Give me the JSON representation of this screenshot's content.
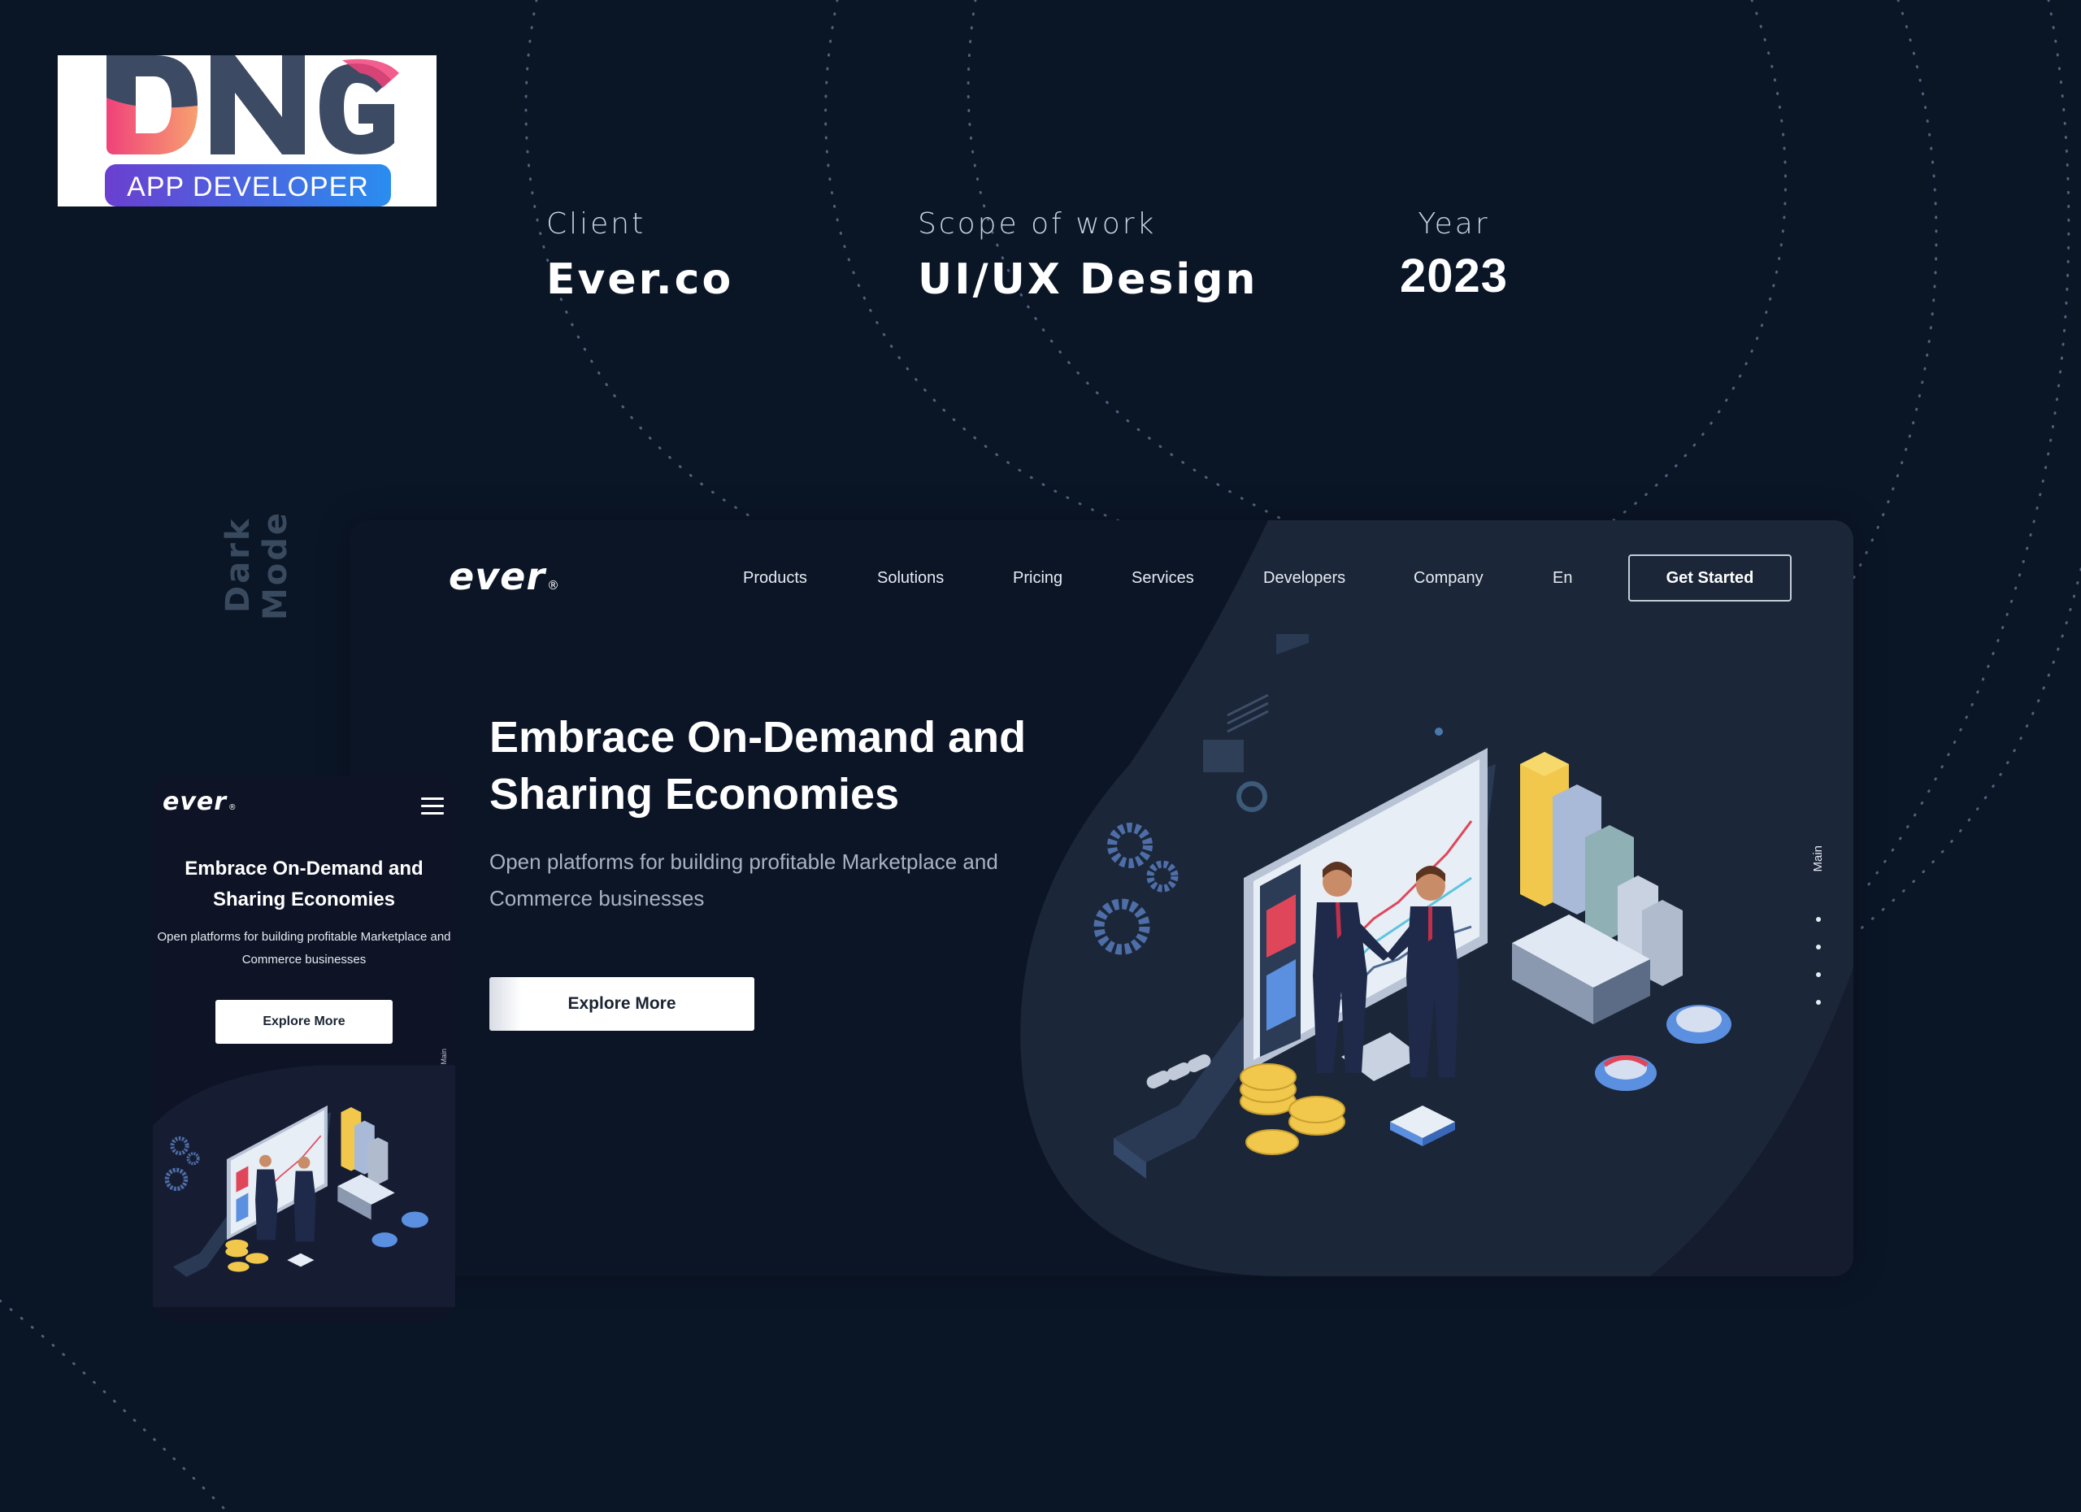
{
  "brand": {
    "name": "DNG",
    "tagline": "APP DEVELOPER",
    "colors": {
      "dark": "#3d4a63",
      "pink": "#f0427a",
      "orange": "#f7a070",
      "purple": "#6a3fd0",
      "blue": "#2a8df0"
    }
  },
  "meta": {
    "client_label": "Client",
    "client_value": "Ever.co",
    "scope_label": "Scope of work",
    "scope_value": "UI/UX Design",
    "year_label": "Year",
    "year_value": "2023"
  },
  "mode_label": "Dark Mode",
  "desktop": {
    "logo": "ever",
    "logo_mark": "®",
    "nav": [
      "Products",
      "Solutions",
      "Pricing",
      "Services",
      "Developers",
      "Company",
      "En"
    ],
    "cta": "Get Started",
    "hero_title": "Embrace On-Demand and Sharing Economies",
    "hero_subtitle": "Open platforms for building profitable Marketplace and Commerce businesses",
    "explore_button": "Explore More",
    "side_nav_label": "Main",
    "side_nav_dots": 4
  },
  "mobile": {
    "logo": "ever",
    "logo_mark": "®",
    "menu_icon": "hamburger-icon",
    "hero_title": "Embrace On-Demand and Sharing Economies",
    "hero_subtitle": "Open platforms for building profitable Marketplace and Commerce businesses",
    "explore_button": "Explore More",
    "side_nav_label": "Main"
  },
  "theme": {
    "background": "#0a1526",
    "panel": "#1a2638",
    "text": "#ffffff",
    "muted_text": "#a8b2c3",
    "gold": "#f1c84b",
    "accent_blue": "#5b8fe0",
    "accent_red": "#e0465a"
  }
}
